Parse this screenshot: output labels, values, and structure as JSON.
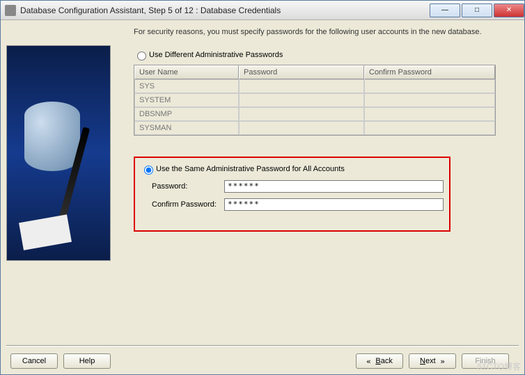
{
  "titlebar": {
    "title": "Database Configuration Assistant, Step 5 of 12 : Database Credentials"
  },
  "intro": "For security reasons, you must specify passwords for the following user accounts in the new database.",
  "option1": {
    "label": "Use Different Administrative Passwords",
    "selected": false
  },
  "table": {
    "headers": {
      "c1": "User Name",
      "c2": "Password",
      "c3": "Confirm Password"
    },
    "rows": [
      {
        "c1": "SYS",
        "c2": "",
        "c3": ""
      },
      {
        "c1": "SYSTEM",
        "c2": "",
        "c3": ""
      },
      {
        "c1": "DBSNMP",
        "c2": "",
        "c3": ""
      },
      {
        "c1": "SYSMAN",
        "c2": "",
        "c3": ""
      }
    ]
  },
  "option2": {
    "label": "Use the Same Administrative Password for All Accounts",
    "selected": true,
    "password_label": "Password:",
    "password_value": "******",
    "confirm_label": "Confirm Password:",
    "confirm_value": "******"
  },
  "buttons": {
    "cancel": "Cancel",
    "help": "Help",
    "back": "Back",
    "next": "Next",
    "finish": "Finish"
  },
  "watermark": "51CTO博客"
}
